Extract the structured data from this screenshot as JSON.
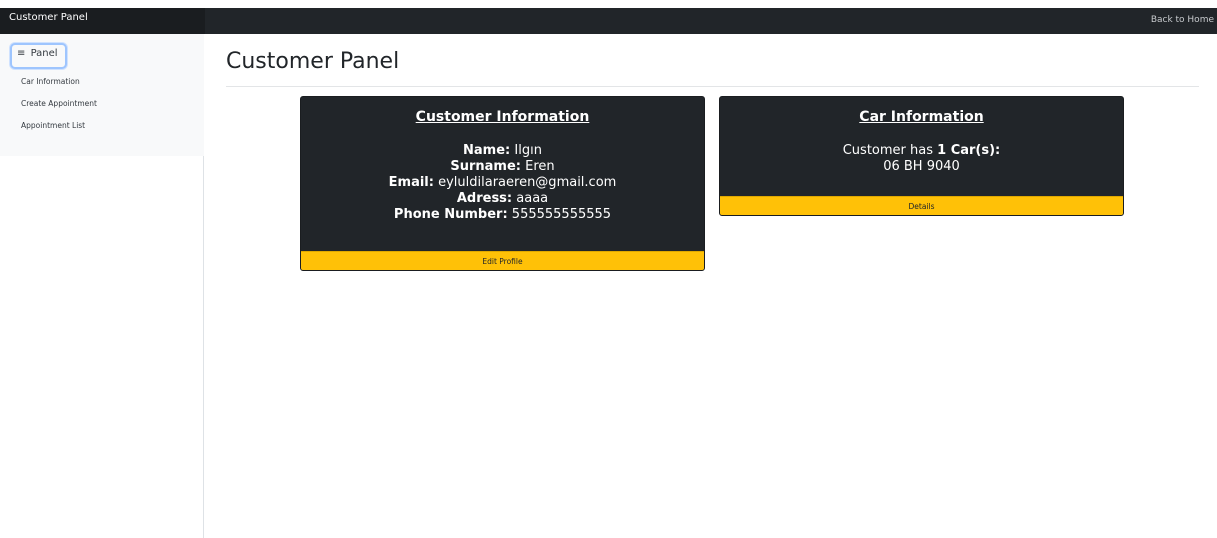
{
  "navbar": {
    "brand": "Customer Panel",
    "back_link": "Back to Home"
  },
  "sidebar": {
    "toggle_label": "Panel",
    "toggle_icon": "hamburger-icon",
    "items": [
      {
        "label": "Car Information"
      },
      {
        "label": "Create Appointment"
      },
      {
        "label": "Appointment List"
      }
    ]
  },
  "main": {
    "title": "Customer Panel"
  },
  "customer_card": {
    "title": "Customer Information",
    "name_label": "Name:",
    "name_value": "Ilgın",
    "surname_label": "Surname:",
    "surname_value": "Eren",
    "email_label": "Email:",
    "email_value": "eyluldilaraeren@gmail.com",
    "address_label": "Adress:",
    "address_value": "aaaa",
    "phone_label": "Phone Number:",
    "phone_value": "555555555555",
    "button_label": "Edit Profile"
  },
  "car_card": {
    "title": "Car Information",
    "count_prefix": "Customer has",
    "count_value": "1 Car(s):",
    "plate": "06 BH 9040",
    "button_label": "Details"
  },
  "colors": {
    "navbar": "#212529",
    "card_bg": "#212529",
    "button": "#ffc107"
  }
}
